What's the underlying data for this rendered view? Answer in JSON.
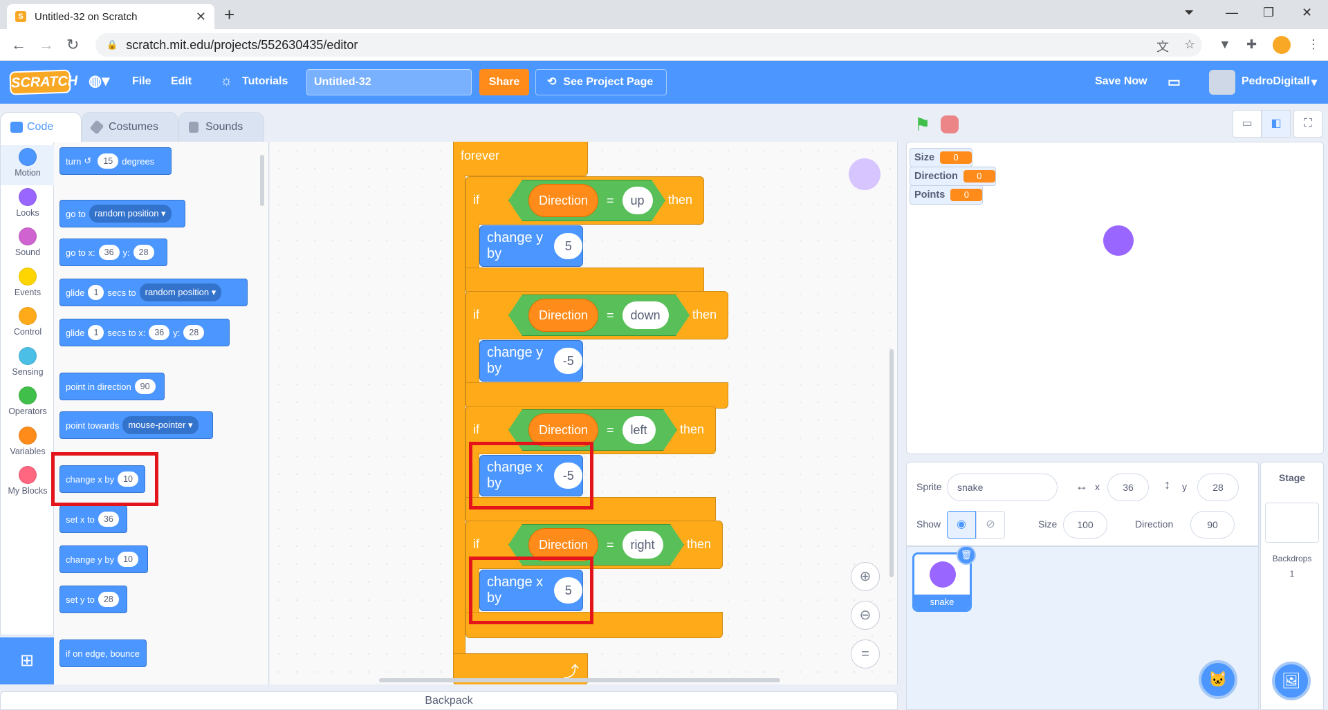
{
  "browser": {
    "tab_title": "Untitled-32 on Scratch",
    "url": "scratch.mit.edu/projects/552630435/editor"
  },
  "menu": {
    "logo": "SCRATCH",
    "file": "File",
    "edit": "Edit",
    "tutorials": "Tutorials",
    "project_title": "Untitled-32",
    "share": "Share",
    "see_project_page": "See Project Page",
    "save_now": "Save Now",
    "username": "PedroDigitall"
  },
  "editor_tabs": {
    "code": "Code",
    "costumes": "Costumes",
    "sounds": "Sounds"
  },
  "categories": [
    {
      "label": "Motion",
      "color": "#4c97ff"
    },
    {
      "label": "Looks",
      "color": "#9966ff"
    },
    {
      "label": "Sound",
      "color": "#cf63cf"
    },
    {
      "label": "Events",
      "color": "#ffd500"
    },
    {
      "label": "Control",
      "color": "#ffab19"
    },
    {
      "label": "Sensing",
      "color": "#4cbfe6"
    },
    {
      "label": "Operators",
      "color": "#40bf4a"
    },
    {
      "label": "Variables",
      "color": "#ff8c1a"
    },
    {
      "label": "My Blocks",
      "color": "#ff6680"
    }
  ],
  "palette": {
    "turn": "turn",
    "turn_deg": "15",
    "degrees": "degrees",
    "go_to": "go to",
    "random_position": "random position",
    "go_to_x": "go to x:",
    "x_val": "36",
    "y_lbl": "y:",
    "y_val": "28",
    "glide": "glide",
    "glide_secs": "1",
    "secs_to": "secs to",
    "secs_to_x": "secs to x:",
    "point_in_direction": "point in direction",
    "direction_val": "90",
    "point_towards": "point towards",
    "mouse_pointer": "mouse-pointer",
    "change_x_by": "change x by",
    "change_x_val": "10",
    "set_x_to": "set x to",
    "set_x_val": "36",
    "change_y_by": "change y by",
    "change_y_val": "10",
    "set_y_to": "set y to",
    "set_y_val": "28",
    "if_on_edge": "if on edge, bounce"
  },
  "script": {
    "forever": "forever",
    "if_word": "if",
    "then_word": "then",
    "eq": "=",
    "variable": "Direction",
    "blocks": [
      {
        "cond": "up",
        "action": "change y by",
        "value": "5"
      },
      {
        "cond": "down",
        "action": "change y by",
        "value": "-5"
      },
      {
        "cond": "left",
        "action": "change x by",
        "value": "-5"
      },
      {
        "cond": "right",
        "action": "change x by",
        "value": "5"
      }
    ],
    "loop_arrow": "⤴"
  },
  "stage": {
    "monitors": [
      {
        "name": "Size",
        "value": "0"
      },
      {
        "name": "Direction",
        "value": "0"
      },
      {
        "name": "Points",
        "value": "0"
      }
    ],
    "sprite_color": "#9966ff"
  },
  "sprite_info": {
    "sprite_label": "Sprite",
    "sprite_name": "snake",
    "x_label": "x",
    "x_value": "36",
    "y_label": "y",
    "y_value": "28",
    "show_label": "Show",
    "size_label": "Size",
    "size_value": "100",
    "direction_label": "Direction",
    "direction_value": "90",
    "thumb_name": "snake"
  },
  "stage_panel": {
    "title": "Stage",
    "backdrops_label": "Backdrops",
    "backdrops_count": "1"
  },
  "backpack": "Backpack"
}
